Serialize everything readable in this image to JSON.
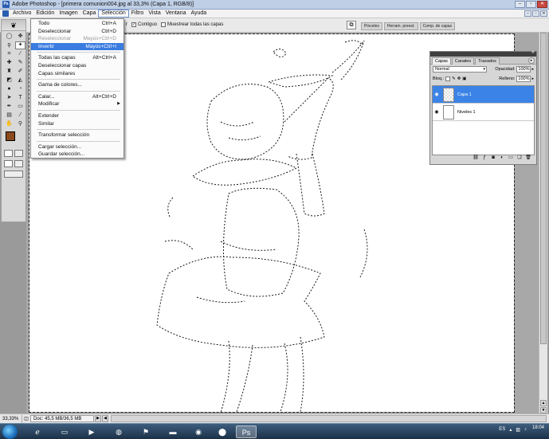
{
  "window": {
    "title": "Adobe Photoshop - [primera comunion004.jpg al 33,3% (Capa 1, RGB/8)]",
    "app_icon": "Ps"
  },
  "menubar": {
    "items": [
      "Archivo",
      "Edición",
      "Imagen",
      "Capa",
      "Selección",
      "Filtro",
      "Vista",
      "Ventana",
      "Ayuda"
    ],
    "active_index": 4
  },
  "options": {
    "checks": [
      {
        "label": "Contiguo",
        "checked": true
      },
      {
        "label": "Muestrear todas las capas",
        "checked": false
      }
    ],
    "partial_left": "r",
    "palette_well": [
      "Pinceles",
      "Herram. preest.",
      "Comp. de capas"
    ]
  },
  "selection_menu": {
    "groups": [
      [
        {
          "label": "Todo",
          "shortcut": "Ctrl+A",
          "state": "normal"
        },
        {
          "label": "Deseleccionar",
          "shortcut": "Ctrl+D",
          "state": "normal"
        },
        {
          "label": "Reseleccionar",
          "shortcut": "Mayús+Ctrl+D",
          "state": "disabled"
        },
        {
          "label": "Invertir",
          "shortcut": "Mayús+Ctrl+I",
          "state": "highlighted"
        }
      ],
      [
        {
          "label": "Todas las capas",
          "shortcut": "Alt+Ctrl+A",
          "state": "normal"
        },
        {
          "label": "Deseleccionar capas",
          "shortcut": "",
          "state": "normal"
        },
        {
          "label": "Capas similares",
          "shortcut": "",
          "state": "normal"
        }
      ],
      [
        {
          "label": "Gama de colores...",
          "shortcut": "",
          "state": "normal"
        }
      ],
      [
        {
          "label": "Calar...",
          "shortcut": "Alt+Ctrl+D",
          "state": "normal"
        },
        {
          "label": "Modificar",
          "shortcut": "",
          "state": "submenu"
        }
      ],
      [
        {
          "label": "Extender",
          "shortcut": "",
          "state": "normal"
        },
        {
          "label": "Similar",
          "shortcut": "",
          "state": "normal"
        }
      ],
      [
        {
          "label": "Transformar selección",
          "shortcut": "",
          "state": "normal"
        }
      ],
      [
        {
          "label": "Cargar selección...",
          "shortcut": "",
          "state": "normal"
        },
        {
          "label": "Guardar selección...",
          "shortcut": "",
          "state": "normal"
        }
      ]
    ]
  },
  "layers_panel": {
    "tabs": [
      "Capas",
      "Canales",
      "Trazados"
    ],
    "active_tab": 0,
    "blend_mode": "Normal",
    "opacity_label": "Opacidad:",
    "opacity": "100%",
    "lock_label": "Bloq.:",
    "fill_label": "Relleno:",
    "fill": "100%",
    "layers": [
      {
        "name": "Capa 1",
        "selected": true,
        "thumb": "checker"
      },
      {
        "name": "Niveles 1",
        "selected": false,
        "thumb": "white"
      }
    ]
  },
  "status": {
    "zoom": "33,33%",
    "doc_info": "Doc: 45,5 MB/36,5 MB"
  },
  "taskbar": {
    "language": "ES",
    "time": "18:04"
  },
  "colors": {
    "foreground": "#8b4a1e",
    "background": "#ffffff",
    "highlight": "#3a7ce0"
  }
}
